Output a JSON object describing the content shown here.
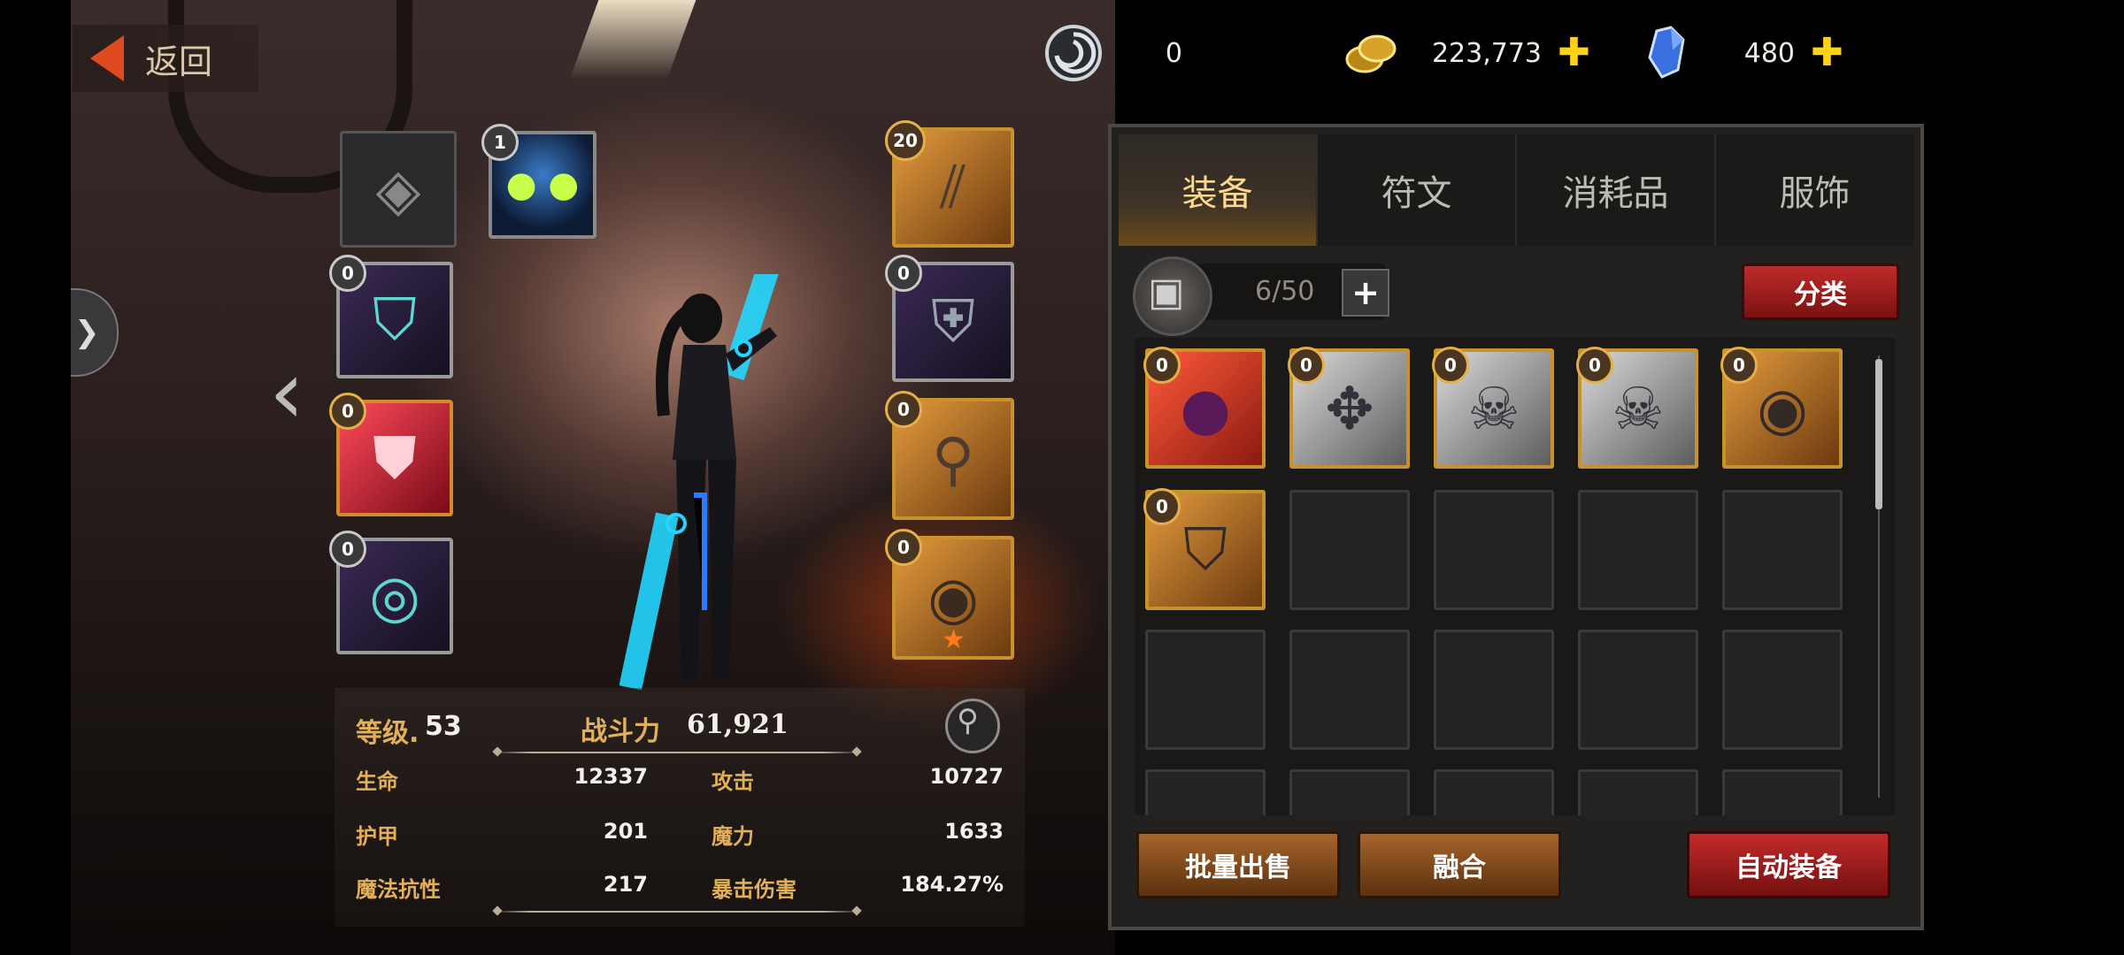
{
  "header": {
    "back_label": "返回",
    "currencies": [
      {
        "icon": "spiral-token-icon",
        "value": "0"
      },
      {
        "icon": "gold-coins-icon",
        "value": "223,773"
      },
      {
        "icon": "blue-crystal-icon",
        "value": "480"
      }
    ]
  },
  "equipment": {
    "left_slots": [
      {
        "name": "mask-slot",
        "level": ""
      },
      {
        "name": "helmet-slot",
        "level": "0"
      },
      {
        "name": "armor-slot",
        "level": "0"
      },
      {
        "name": "belt-slot",
        "level": "0"
      }
    ],
    "pet_slot": {
      "level": "1"
    },
    "right_slots": [
      {
        "name": "weapon-slot",
        "level": "20"
      },
      {
        "name": "shoulder-slot",
        "level": "0"
      },
      {
        "name": "boots-slot",
        "level": "0"
      },
      {
        "name": "ring-slot",
        "level": "0"
      }
    ]
  },
  "stats": {
    "level_label": "等级.",
    "level_value": "53",
    "power_label": "战斗力",
    "power_value": "61,921",
    "rows": [
      {
        "l1": "生命",
        "v1": "12337",
        "l2": "攻击",
        "v2": "10727"
      },
      {
        "l1": "护甲",
        "v1": "201",
        "l2": "魔力",
        "v2": "1633"
      },
      {
        "l1": "魔法抗性",
        "v1": "217",
        "l2": "暴击伤害",
        "v2": "184.27%"
      }
    ]
  },
  "inventory": {
    "tabs": [
      "装备",
      "符文",
      "消耗品",
      "服饰"
    ],
    "active_tab": "装备",
    "capacity": "6/50",
    "sort_label": "分类",
    "items": [
      {
        "level": "0",
        "kind": "red",
        "icon": "orb-icon"
      },
      {
        "level": "0",
        "kind": "silver",
        "icon": "gauntlet-icon"
      },
      {
        "level": "0",
        "kind": "silver",
        "icon": "skull-bracer-icon"
      },
      {
        "level": "0",
        "kind": "silver",
        "icon": "skull-bracer-icon"
      },
      {
        "level": "0",
        "kind": "gold",
        "icon": "ring-icon"
      },
      {
        "level": "0",
        "kind": "gold",
        "icon": "helmet-icon"
      }
    ],
    "bulk_sell_label": "批量出售",
    "merge_label": "融合",
    "auto_equip_label": "自动装备"
  },
  "colors": {
    "accent_gold": "#e3b05a",
    "button_red": "#c02a2a",
    "button_brown": "#a7652b",
    "currency_plus": "#ffd21a"
  }
}
